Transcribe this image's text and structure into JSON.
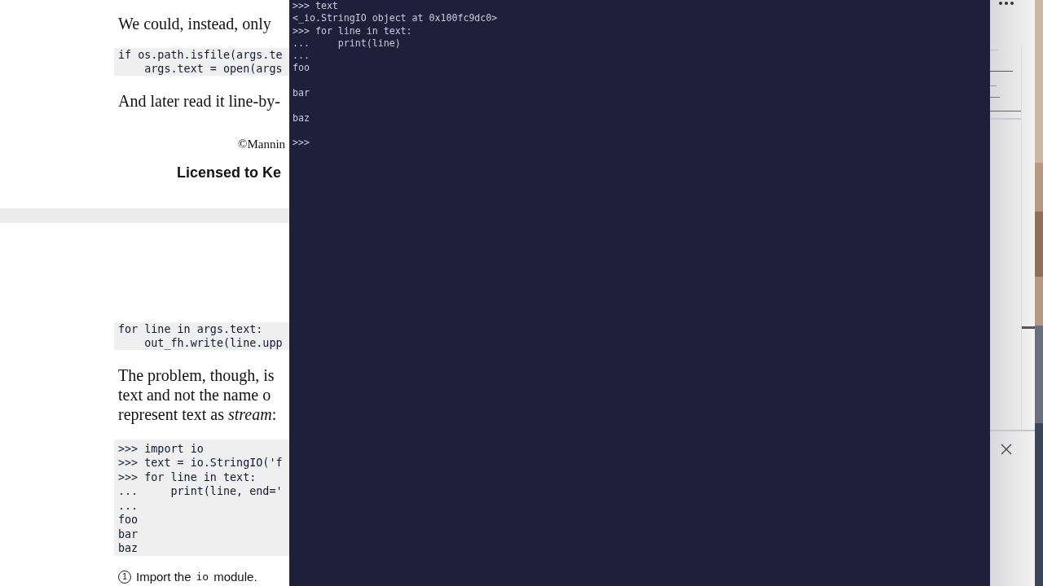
{
  "document": {
    "blocks": [
      {
        "kind": "para",
        "lines": [
          "We could, instead, only"
        ]
      },
      {
        "kind": "code",
        "lines": [
          "if os.path.isfile(args.te",
          "    args.text = open(args"
        ]
      },
      {
        "kind": "para",
        "lines": [
          "And later read it line-by-"
        ]
      },
      {
        "kind": "copyright",
        "lines": [
          "©Mannin"
        ]
      },
      {
        "kind": "license",
        "lines": [
          "Licensed to Ke"
        ]
      },
      {
        "kind": "pagebreak"
      },
      {
        "kind": "code",
        "lines": [
          "for line in args.text:",
          "    out_fh.write(line.upp"
        ]
      },
      {
        "kind": "para",
        "lines": [
          "The problem, though, is",
          "text and not the name o",
          "represent text as *stream*:"
        ]
      },
      {
        "kind": "code",
        "lines": [
          ">>> import io",
          ">>> text = io.StringIO('f",
          ">>> for line in text:",
          "...     print(line, end='",
          "...",
          "foo",
          "bar",
          "baz"
        ]
      },
      {
        "kind": "callout",
        "number": "1",
        "before": "Import the",
        "code": "io",
        "after": "module."
      }
    ]
  },
  "terminal": {
    "lines": [
      {
        "text": ">>> text",
        "gap_after": false
      },
      {
        "text": "<_io.StringIO object at 0x100fc9dc0>",
        "gap_after": false
      },
      {
        "text": ">>> for line in text:",
        "gap_after": false
      },
      {
        "text": "...     print(line)",
        "gap_after": false
      },
      {
        "text": "...",
        "gap_after": false
      },
      {
        "text": "foo",
        "gap_after": true
      },
      {
        "text": "bar",
        "gap_after": true
      },
      {
        "text": "baz",
        "gap_after": true
      },
      {
        "text": ">>>",
        "gap_after": false
      }
    ]
  }
}
